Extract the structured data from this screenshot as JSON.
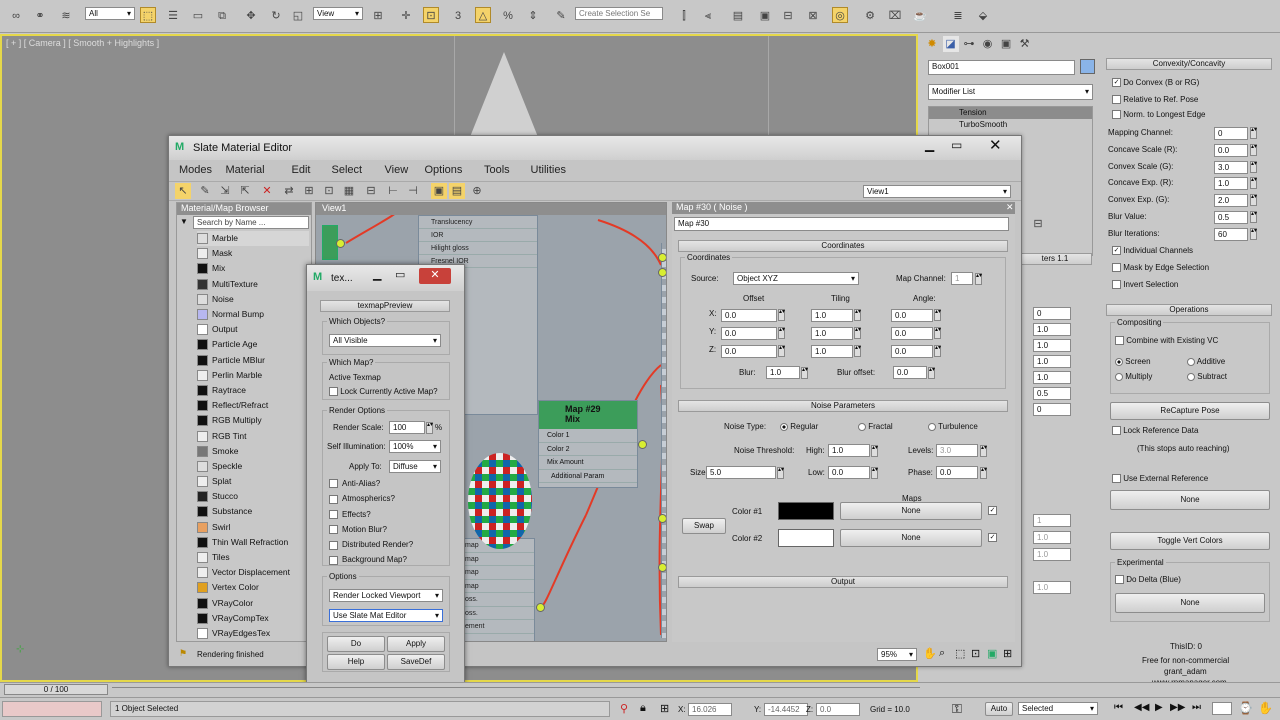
{
  "viewport": {
    "label": "[ + ] [ Camera ] [ Smooth + Highlights ]"
  },
  "main_toolbar": {
    "filter": "All",
    "ref_coord": "View",
    "named_selection": "Create Selection Se"
  },
  "right_panel": {
    "object_name": "Box001",
    "modifier_list": "Modifier List",
    "stack": [
      "Tension",
      "TurboSmooth"
    ],
    "partial_params": "ters 1.1",
    "partial_values": [
      "0",
      "1.0",
      "1.0",
      "1.0",
      "1.0",
      "0.5",
      "0"
    ],
    "partial_lower": [
      "1",
      "1.0",
      "1.0",
      "1.0"
    ],
    "convexity": {
      "title": "Convexity/Concavity",
      "do_convex": "Do Convex (B or RG)",
      "relative": "Relative to Ref. Pose",
      "norm": "Norm. to Longest Edge",
      "params": [
        {
          "label": "Mapping Channel:",
          "value": "0"
        },
        {
          "label": "Concave Scale (R):",
          "value": "0.0"
        },
        {
          "label": "Convex Scale (G):",
          "value": "3.0"
        },
        {
          "label": "Concave Exp. (R):",
          "value": "1.0"
        },
        {
          "label": "Convex Exp. (G):",
          "value": "2.0"
        },
        {
          "label": "Blur Value:",
          "value": "0.5"
        },
        {
          "label": "Blur Iterations:",
          "value": "60"
        }
      ],
      "individual": "Individual Channels",
      "mask_edge": "Mask by Edge Selection",
      "invert": "Invert Selection"
    },
    "operations": {
      "title": "Operations",
      "compositing": "Compositing",
      "combine": "Combine with Existing VC",
      "screen": "Screen",
      "additive": "Additive",
      "multiply": "Multiply",
      "subtract": "Subtract",
      "recapture": "ReCapture Pose",
      "lock_ref": "Lock Reference Data",
      "lock_note": "(This stops auto reaching)",
      "use_ext": "Use External Reference",
      "none1": "None",
      "toggle": "Toggle Vert Colors",
      "experimental": "Experimental",
      "do_delta": "Do Delta (Blue)",
      "none2": "None",
      "this_id": "ThisID: 0",
      "free": "Free for non-commercial",
      "author": "grant_adam",
      "site": "www.rpmanager.com"
    }
  },
  "slate": {
    "title": "Slate Material Editor",
    "menu": [
      "Modes",
      "Material",
      "Edit",
      "Select",
      "View",
      "Options",
      "Tools",
      "Utilities"
    ],
    "view_dropdown": "View1",
    "browser_title": "Material/Map Browser",
    "search_placeholder": "Search by Name ...",
    "maps": [
      "Marble",
      "Mask",
      "Mix",
      "MultiTexture",
      "Noise",
      "Normal Bump",
      "Output",
      "Particle Age",
      "Particle MBlur",
      "Perlin Marble",
      "Raytrace",
      "Reflect/Refract",
      "RGB Multiply",
      "RGB Tint",
      "Smoke",
      "Speckle",
      "Splat",
      "Stucco",
      "Substance",
      "Swirl",
      "Thin Wall Refraction",
      "Tiles",
      "Vector Displacement",
      "Vertex Color",
      "VRayColor",
      "VRayCompTex",
      "VRayEdgesTex"
    ],
    "view_tab": "View1",
    "status": "Rendering finished",
    "zoom": "95%",
    "node_slots": [
      "Translucency",
      "IOR",
      "Hilight gloss",
      "Fresnel IOR"
    ],
    "node_lower": [
      "map",
      "map",
      "map",
      "map",
      "oss.",
      "oss.",
      "ement"
    ],
    "mix_node": {
      "title": "Map #29",
      "subtitle": "Mix",
      "inputs": [
        "Color 1",
        "Color 2",
        "Mix Amount",
        "Additional Param"
      ]
    },
    "props": {
      "header": "Map #30  ( Noise )",
      "name": "Map #30",
      "coords_title": "Coordinates",
      "coords_group": "Coordinates",
      "source_label": "Source:",
      "source": "Object XYZ",
      "map_channel_label": "Map Channel:",
      "map_channel": "1",
      "offset": "Offset",
      "tiling": "Tiling",
      "angle": "Angle:",
      "rows": [
        {
          "axis": "X:",
          "offset": "0.0",
          "tiling": "1.0",
          "angle": "0.0"
        },
        {
          "axis": "Y:",
          "offset": "0.0",
          "tiling": "1.0",
          "angle": "0.0"
        },
        {
          "axis": "Z:",
          "offset": "0.0",
          "tiling": "1.0",
          "angle": "0.0"
        }
      ],
      "blur_label": "Blur:",
      "blur": "1.0",
      "blur_offset_label": "Blur offset:",
      "blur_offset": "0.0",
      "noise_title": "Noise Parameters",
      "noise_type": "Noise Type:",
      "regular": "Regular",
      "fractal": "Fractal",
      "turbulence": "Turbulence",
      "threshold": "Noise Threshold:",
      "high_label": "High:",
      "high": "1.0",
      "levels_label": "Levels:",
      "levels": "3.0",
      "size_label": "Size:",
      "size": "5.0",
      "low_label": "Low:",
      "low": "0.0",
      "phase_label": "Phase:",
      "phase": "0.0",
      "maps": "Maps",
      "swap": "Swap",
      "color1": "Color #1",
      "color2": "Color #2",
      "none": "None",
      "output": "Output"
    }
  },
  "texmap": {
    "title": "tex...",
    "rollout": "texmapPreview",
    "which_objects": "Which Objects?",
    "objects_value": "All Visible",
    "which_map": "Which Map?",
    "active_texmap": "Active Texmap",
    "lock_map": "Lock Currently Active Map?",
    "render_options": "Render Options",
    "render_scale_label": "Render Scale:",
    "render_scale": "100",
    "percent": "%",
    "self_illum_label": "Self Illumination:",
    "self_illum": "100%",
    "apply_label": "Apply To:",
    "apply": "Diffuse",
    "checks": [
      "Anti-Alias?",
      "Atmospherics?",
      "Effects?",
      "Motion Blur?",
      "Distributed Render?",
      "Background Map?"
    ],
    "options": "Options",
    "opt1": "Render Locked Viewport",
    "opt2": "Use Slate Mat Editor",
    "do": "Do",
    "apply_btn": "Apply",
    "help": "Help",
    "savedef": "SaveDef"
  },
  "statusbar": {
    "frames": "0 / 100",
    "selected": "1 Object Selected",
    "x_label": "X:",
    "x": "16.026",
    "y_label": "Y:",
    "y": "-14.4452",
    "z_label": "Z:",
    "z": "0.0",
    "grid": "Grid = 10.0",
    "auto": "Auto",
    "sel_mode": "Selected"
  },
  "colors": {
    "viewport_bg": "#8d8d8d",
    "grid_yellow": "#e5d84a",
    "node_green": "#3c9d5a",
    "wire_red": "#e33a26",
    "color1": "#000000",
    "color2": "#ffffff"
  }
}
